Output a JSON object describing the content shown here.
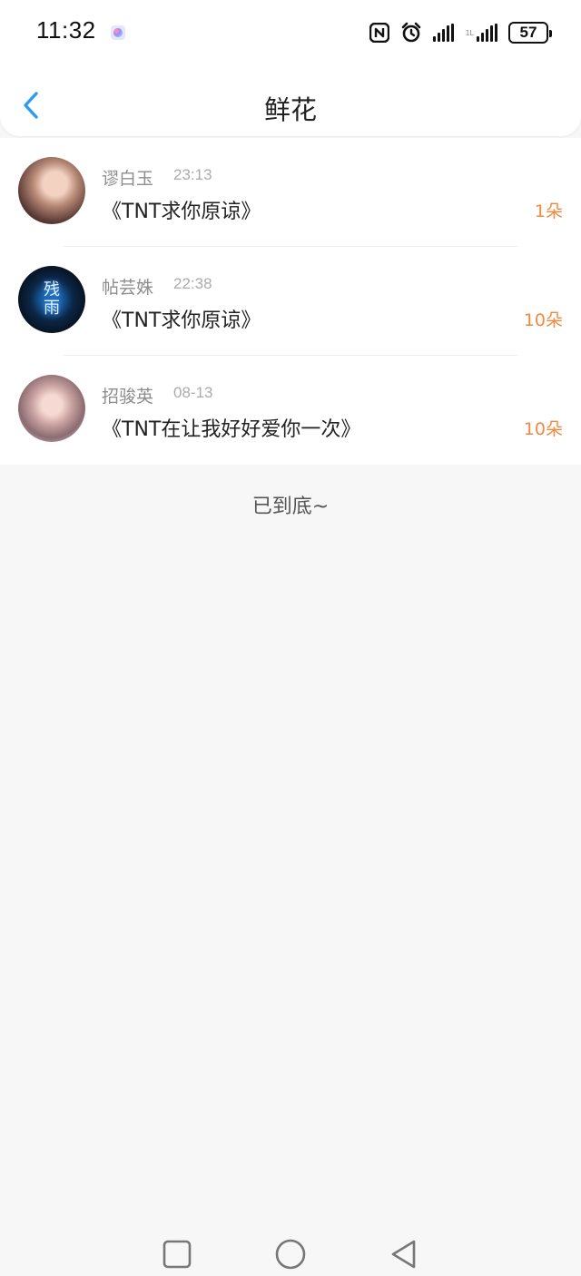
{
  "status_bar": {
    "time": "11:32",
    "battery": "57",
    "signal_label": "1L"
  },
  "nav": {
    "title": "鲜花"
  },
  "items": [
    {
      "name": "谬白玉",
      "time": "23:13",
      "song": "《TNT求你原谅》",
      "count": "1朵"
    },
    {
      "name": "帖芸姝",
      "time": "22:38",
      "song": "《TNT求你原谅》",
      "count": "10朵",
      "avatar_text": "残雨"
    },
    {
      "name": "招骏英",
      "time": "08-13",
      "song": "《TNT在让我好好爱你一次》",
      "count": "10朵"
    }
  ],
  "end_text": "已到底~",
  "colors": {
    "accent_blue": "#2b9cf0",
    "count_orange": "#f08a3e"
  },
  "icons": [
    "nfc-icon",
    "alarm-icon",
    "back-icon",
    "square-nav-icon",
    "circle-nav-icon",
    "triangle-back-nav-icon"
  ]
}
